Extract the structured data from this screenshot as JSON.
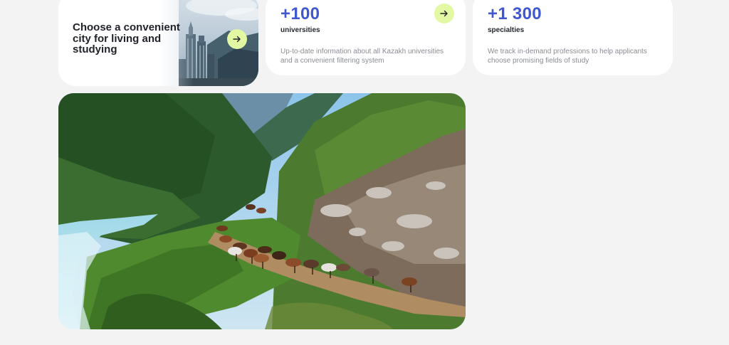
{
  "city_card": {
    "title": "Choose a convenient city for living and studying",
    "arrow_icon": "arrow-right-icon"
  },
  "stats": {
    "universities": {
      "number": "+100",
      "label": "universities",
      "description": "Up-to-date information about all Kazakh universities and a convenient filtering system"
    },
    "specialties": {
      "number": "+1 300",
      "label": "specialties",
      "description": "We track in-demand professions to help applicants choose promising fields of study"
    }
  },
  "colors": {
    "accent": "#3f57d1",
    "button": "#e3f8a3",
    "background": "#f3f3f3"
  }
}
